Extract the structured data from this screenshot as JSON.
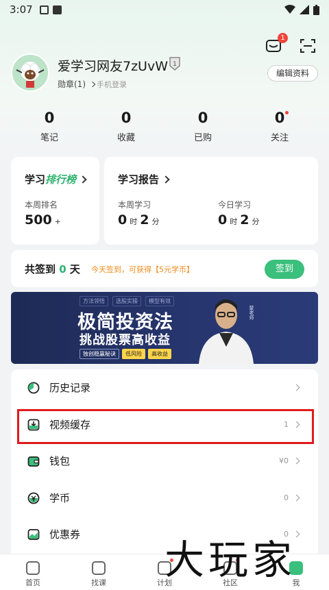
{
  "status_bar": {
    "time": "3:07"
  },
  "top_bar": {
    "message_badge": "1"
  },
  "profile": {
    "username": "爱学习网友7zUvW",
    "medal_label": "勋章(1)",
    "login_method": "手机登录",
    "edit_label": "编辑资料"
  },
  "stats": [
    {
      "value": "0",
      "label": "笔记"
    },
    {
      "value": "0",
      "label": "收藏"
    },
    {
      "value": "0",
      "label": "已购"
    },
    {
      "value": "0",
      "label": "关注"
    }
  ],
  "ranking": {
    "title_a": "学习",
    "title_b": "排行榜",
    "week_rank_label": "本周排名",
    "week_rank_value": "500",
    "week_rank_suffix": "+"
  },
  "report": {
    "title": "学习报告",
    "week_label": "本周学习",
    "week_hours": "0",
    "week_minutes": "2",
    "today_label": "今日学习",
    "today_hours": "0",
    "today_minutes": "2",
    "hour_unit": "时",
    "minute_unit": "分"
  },
  "checkin": {
    "prefix": "共签到",
    "days": "0",
    "suffix": "天",
    "tip": "今天签到，可获得【5元学币】",
    "button": "签到"
  },
  "banner": {
    "tags": [
      "方法领悟",
      "选股实操",
      "模型有效"
    ],
    "title": "极简投资法",
    "subtitle": "挑战股票高收益",
    "chips": [
      "独创稳赢秘诀",
      "低风险",
      "高收益"
    ],
    "teacher": "蒙老师"
  },
  "menu": [
    {
      "label": "历史记录",
      "value": ""
    },
    {
      "label": "视频缓存",
      "value": "1"
    },
    {
      "label": "钱包",
      "value": "¥0"
    },
    {
      "label": "学币",
      "value": "0"
    },
    {
      "label": "优惠券",
      "value": "0"
    }
  ],
  "tabs": [
    {
      "label": "首页"
    },
    {
      "label": "找课"
    },
    {
      "label": "计划"
    },
    {
      "label": "社区"
    },
    {
      "label": "我"
    }
  ],
  "watermark": "大玩家",
  "colors": {
    "accent": "#3bbf7c",
    "badge": "#f0453a",
    "highlight": "#e01a1a",
    "tip": "#f08a1c"
  }
}
